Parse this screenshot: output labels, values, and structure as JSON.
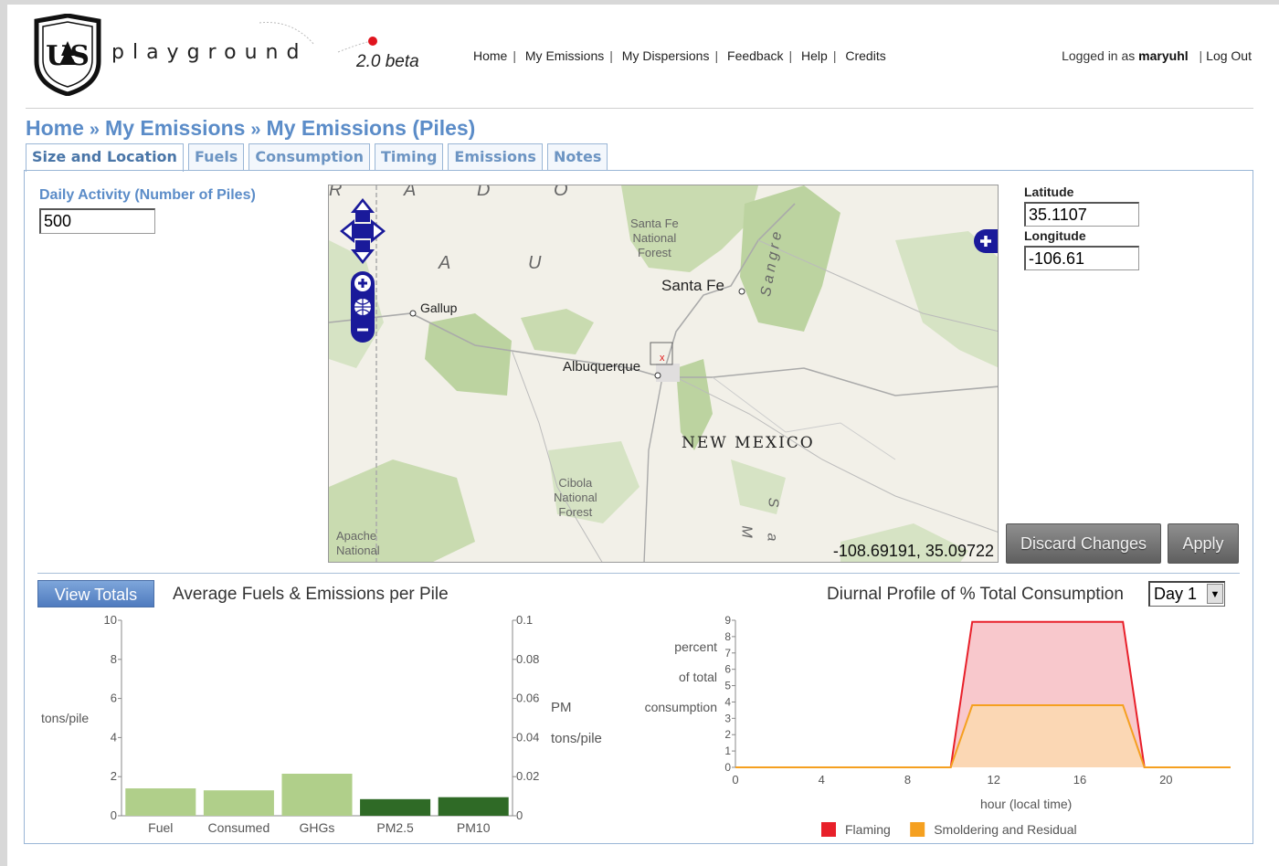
{
  "header": {
    "brand": "playground",
    "version": "2.0 beta",
    "nav": [
      "Home",
      "My Emissions",
      "My Dispersions",
      "Feedback",
      "Help",
      "Credits"
    ],
    "logged_in_prefix": "Logged in as",
    "username": "maryuhl",
    "logout": "Log Out",
    "logo_text": "US"
  },
  "breadcrumb": [
    "Home",
    "My Emissions",
    "My Emissions (Piles)"
  ],
  "tabs": [
    "Size and Location",
    "Fuels",
    "Consumption",
    "Timing",
    "Emissions",
    "Notes"
  ],
  "active_tab": "Size and Location",
  "form": {
    "daily_activity_label": "Daily Activity (Number of Piles)",
    "daily_activity_value": "500",
    "latitude_label": "Latitude",
    "latitude_value": "35.1107",
    "longitude_label": "Longitude",
    "longitude_value": "-106.61",
    "discard_label": "Discard Changes",
    "apply_label": "Apply"
  },
  "map": {
    "coords": "-108.69191, 35.09722",
    "labels": {
      "santa_fe": "Santa Fe",
      "gallup": "Gallup",
      "albuquerque": "Albuquerque",
      "new_mexico": "NEW MEXICO",
      "santa_fe_nf": "Santa Fe\nNational\nForest",
      "cibola_nf": "Cibola\nNational\nForest",
      "apache_nf": "Apache\nNational",
      "sangre": "Sangre",
      "big_a": "A",
      "big_u": "U",
      "top_r": "R",
      "top_a": "A",
      "top_d": "D",
      "top_o": "O",
      "side_m": "M",
      "side_s": "S",
      "side_a2": "a"
    },
    "marker": "x"
  },
  "bottom": {
    "view_totals": "View Totals",
    "avg_title": "Average Fuels & Emissions per Pile",
    "diurnal_title": "Diurnal Profile of % Total Consumption",
    "day_selected": "Day 1"
  },
  "chart_data": [
    {
      "type": "bar",
      "title": "Average Fuels & Emissions per Pile",
      "categories": [
        "Fuel",
        "Consumed",
        "GHGs",
        "PM2.5",
        "PM10"
      ],
      "left_axis": {
        "label": "tons/pile",
        "ylim": [
          0,
          10
        ],
        "ticks": [
          0,
          2,
          4,
          6,
          8,
          10
        ],
        "series_categories": [
          "Fuel",
          "Consumed",
          "GHGs"
        ]
      },
      "right_axis": {
        "label_line1": "PM",
        "label_line2": "tons/pile",
        "ylim": [
          0,
          0.1
        ],
        "ticks": [
          0,
          0.02,
          0.04,
          0.06,
          0.08,
          0.1
        ],
        "series_categories": [
          "PM2.5",
          "PM10"
        ]
      },
      "values": [
        1.4,
        1.3,
        2.15,
        0.0085,
        0.0095
      ],
      "axis_scale": [
        "left",
        "left",
        "left",
        "right",
        "right"
      ],
      "colors": [
        "#b0cf8a",
        "#b0cf8a",
        "#b0cf8a",
        "#2f6a26",
        "#2f6a26"
      ]
    },
    {
      "type": "area",
      "title": "Diurnal Profile of % Total Consumption",
      "xlabel": "hour (local time)",
      "ylabel_lines": [
        "percent",
        "of total",
        "consumption"
      ],
      "xlim": [
        0,
        23
      ],
      "ylim": [
        0,
        9
      ],
      "xticks": [
        0,
        4,
        8,
        12,
        16,
        20
      ],
      "yticks": [
        0,
        1,
        2,
        3,
        4,
        5,
        6,
        7,
        8,
        9
      ],
      "series": [
        {
          "name": "Flaming",
          "color": "#e8202a",
          "fill": "#f8c8cc",
          "x": [
            0,
            10,
            11,
            18,
            19,
            23
          ],
          "y": [
            0,
            0,
            8.9,
            8.9,
            0,
            0
          ]
        },
        {
          "name": "Smoldering and Residual",
          "color": "#f5a020",
          "fill": "#fbd7b4",
          "x": [
            0,
            10,
            11,
            18,
            19,
            23
          ],
          "y": [
            0,
            0,
            3.8,
            3.8,
            0,
            0
          ]
        }
      ]
    }
  ]
}
